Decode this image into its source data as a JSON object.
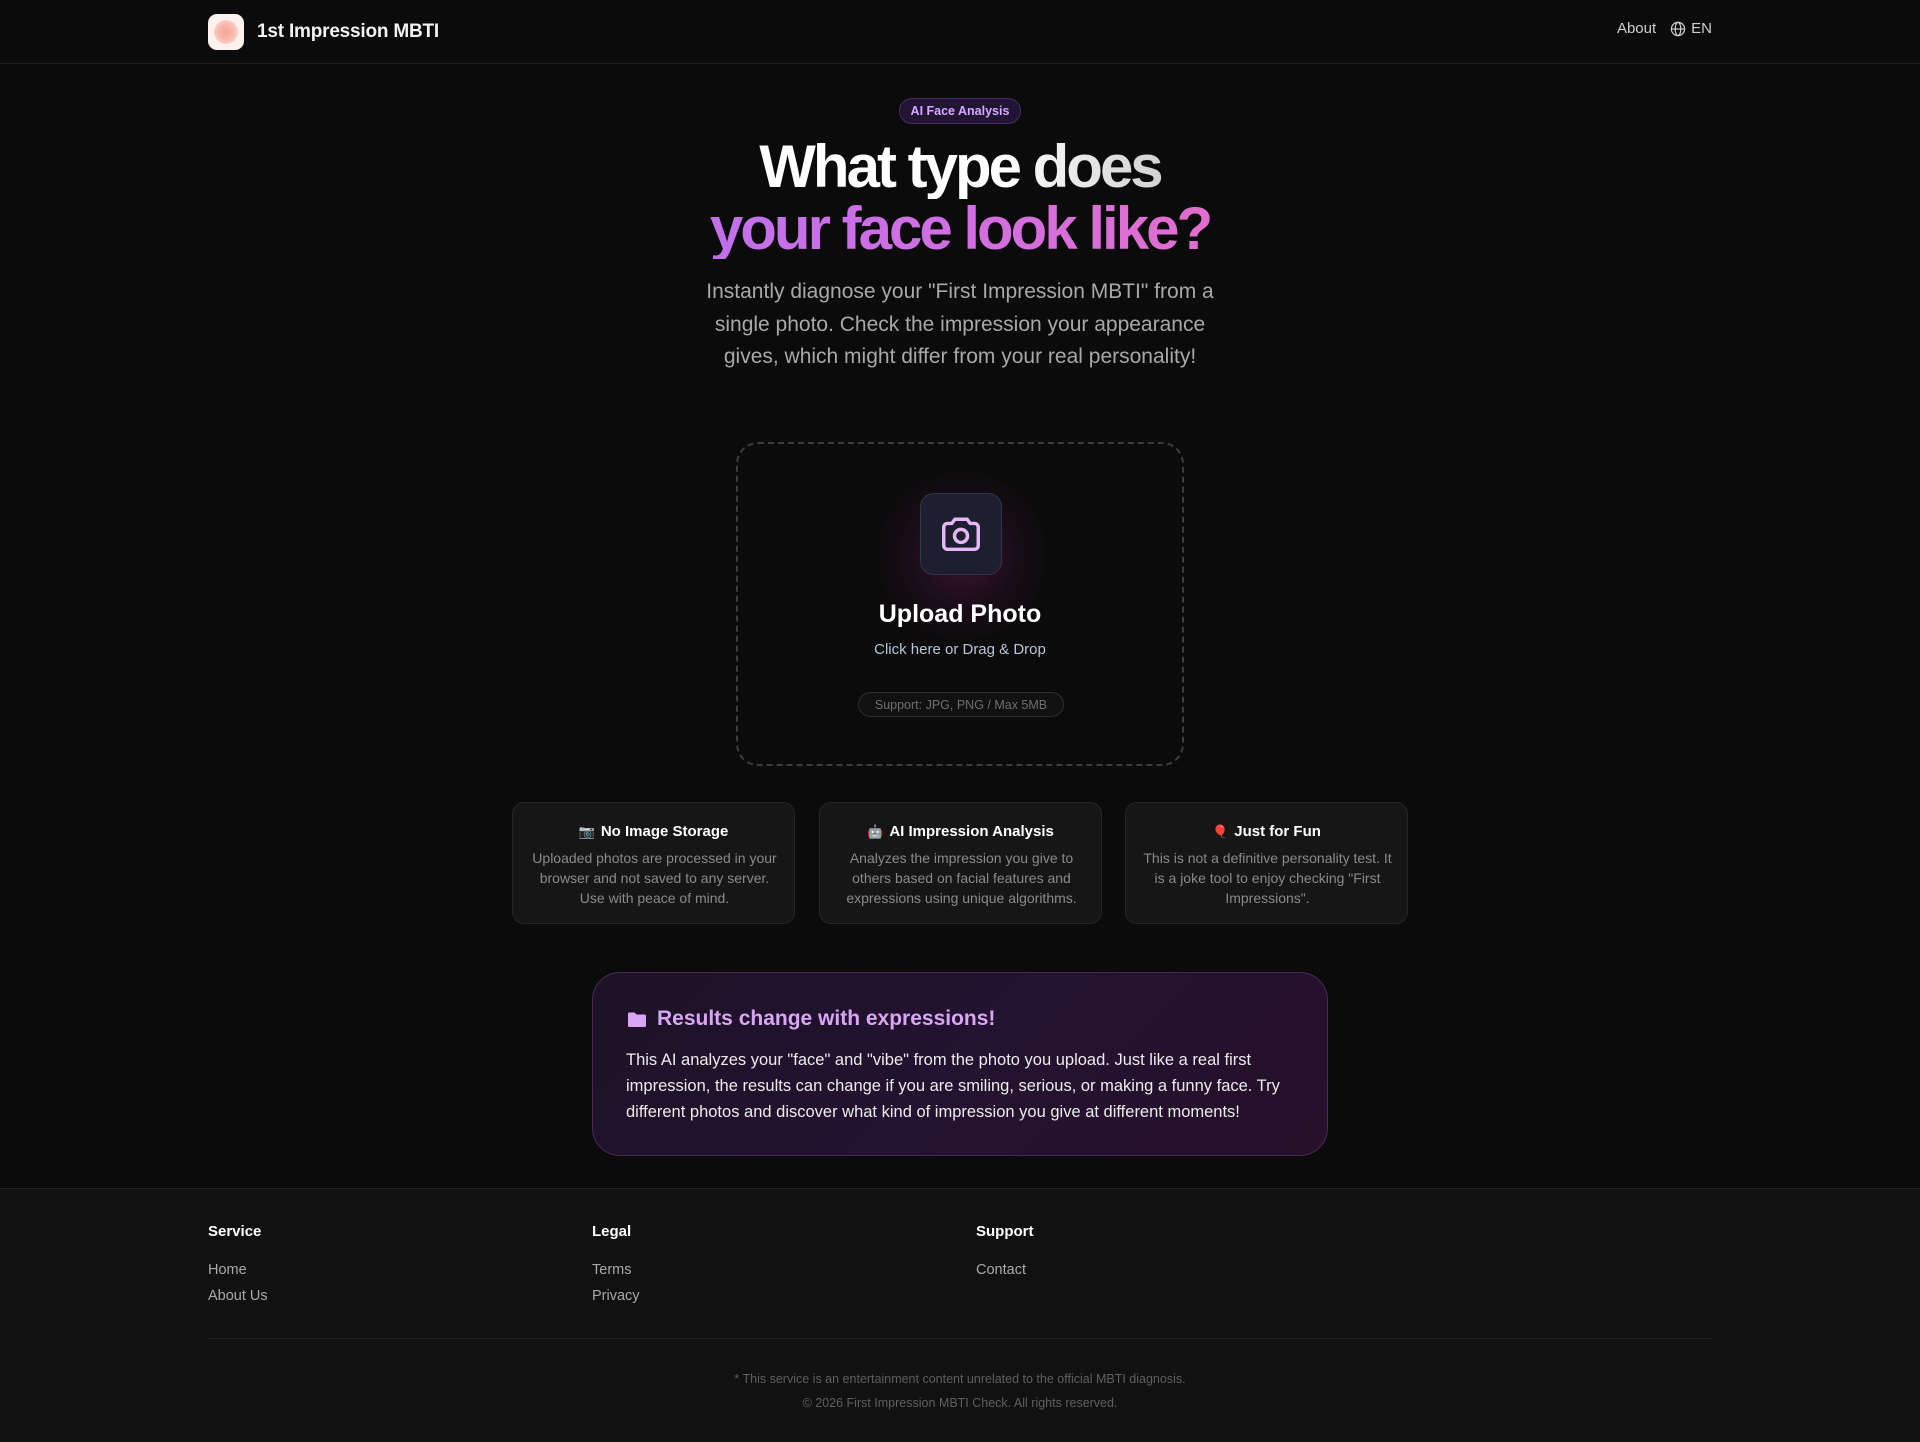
{
  "header": {
    "brand_name": "1st Impression MBTI",
    "nav_about": "About",
    "lang_label": "EN"
  },
  "hero": {
    "badge": "AI Face Analysis",
    "headline_line1": "What type does",
    "headline_line2": "your face look like?",
    "description": "Instantly diagnose your \"First Impression MBTI\" from a single photo. Check the impression your appearance gives, which might differ from your real personality!"
  },
  "upload": {
    "icon": "camera-icon",
    "title": "Upload Photo",
    "subtitle": "Click here or Drag & Drop",
    "support": "Support: JPG, PNG / Max 5MB"
  },
  "features": [
    {
      "icon": "📷",
      "title": "No Image Storage",
      "body": "Uploaded photos are processed in your browser and not saved to any server. Use with peace of mind."
    },
    {
      "icon": "🤖",
      "title": "AI Impression Analysis",
      "body": "Analyzes the impression you give to others based on facial features and expressions using unique algorithms."
    },
    {
      "icon": "🎈",
      "title": "Just for Fun",
      "body": "This is not a definitive personality test. It is a joke tool to enjoy checking \"First Impressions\"."
    }
  ],
  "info": {
    "icon": "folder-icon",
    "title": "Results change with expressions!",
    "body": "This AI analyzes your \"face\" and \"vibe\" from the photo you upload. Just like a real first impression, the results can change if you are smiling, serious, or making a funny face. Try different photos and discover what kind of impression you give at different moments!"
  },
  "footer": {
    "service": {
      "heading": "Service",
      "links": [
        "Home",
        "About Us"
      ]
    },
    "legal": {
      "heading": "Legal",
      "links": [
        "Terms",
        "Privacy"
      ]
    },
    "support": {
      "heading": "Support",
      "links": [
        "Contact"
      ]
    },
    "disclaimer": "* This service is an entertainment content unrelated to the official MBTI diagnosis.",
    "copyright": "© 2026 First Impression MBTI Check. All rights reserved."
  },
  "colors": {
    "background": "#0b0b0b",
    "accent_purple": "#b770ee",
    "accent_pink": "#ec6cc1",
    "badge_text": "#d7a8ff"
  }
}
